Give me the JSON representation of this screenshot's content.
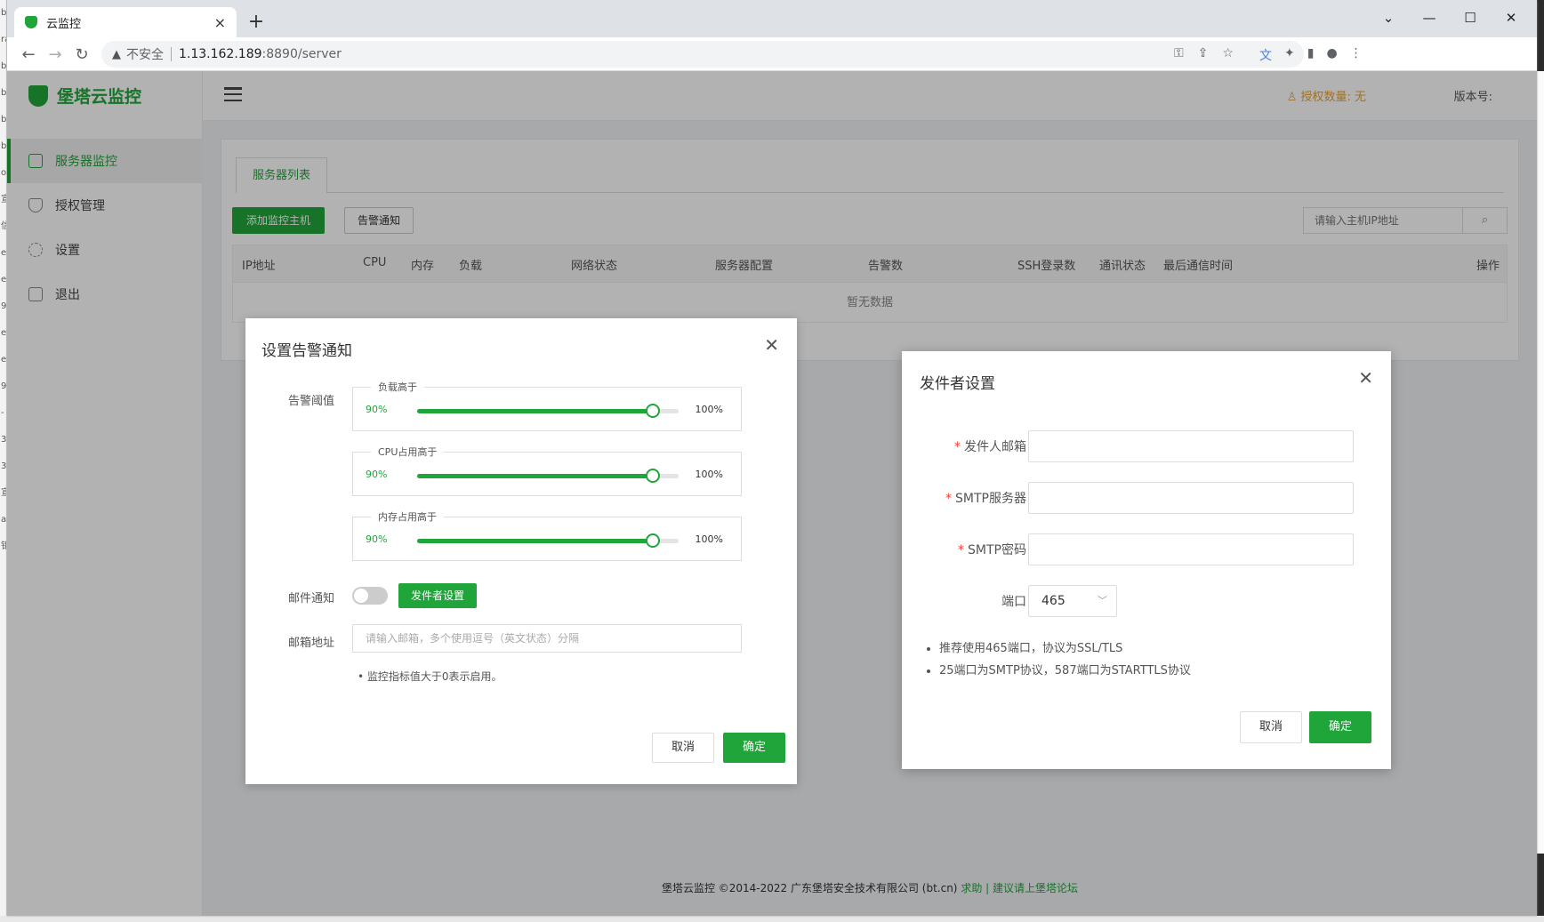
{
  "desktop": {
    "left_glyphs": [
      "b",
      "ra",
      "b",
      "b",
      "b",
      "b",
      "o",
      "宣",
      "信",
      "e",
      "e",
      "9",
      "e",
      "e",
      "9",
      "-",
      "3",
      "3",
      "宣",
      "a",
      "钜"
    ]
  },
  "browser": {
    "tab_title": "云监控",
    "tab_close": "×",
    "new_tab": "+",
    "security_label": "不安全",
    "url_host": "1.13.162.189",
    "url_rest": ":8890/server"
  },
  "app": {
    "brand": "堡塔云监控",
    "auth_text": "授权数量: 无",
    "version_label": "版本号:",
    "menu": [
      {
        "label": "服务器监控",
        "icon": "monitor-icon"
      },
      {
        "label": "授权管理",
        "icon": "shield-check-icon"
      },
      {
        "label": "设置",
        "icon": "gear-icon"
      },
      {
        "label": "退出",
        "icon": "logout-icon"
      }
    ],
    "tab_server_list": "服务器列表",
    "btn_add_host": "添加监控主机",
    "btn_alert_notify": "告警通知",
    "search_placeholder": "请输入主机IP地址",
    "columns": [
      "IP地址",
      "CPU",
      "内存",
      "负载",
      "网络状态",
      "服务器配置",
      "告警数",
      "SSH登录数",
      "通讯状态",
      "最后通信时间",
      "操作"
    ],
    "empty_text": "暂无数据",
    "footer_text": "堡塔云监控 ©2014-2022 广东堡塔安全技术有限公司 (bt.cn)",
    "footer_help": "求助",
    "footer_sep": "|",
    "footer_forum": "建议请上堡塔论坛"
  },
  "alert_dialog": {
    "title": "设置告警通知",
    "threshold_label": "告警阈值",
    "sliders": [
      {
        "legend": "负载高于",
        "value_text": "90%",
        "max_text": "100%",
        "value": 0.9
      },
      {
        "legend": "CPU占用高于",
        "value_text": "90%",
        "max_text": "100%",
        "value": 0.9
      },
      {
        "legend": "内存占用高于",
        "value_text": "90%",
        "max_text": "100%",
        "value": 0.9
      }
    ],
    "mail_notify_label": "邮件通知",
    "sender_settings_btn": "发件者设置",
    "email_label": "邮箱地址",
    "email_placeholder": "请输入邮箱，多个使用逗号（英文状态）分隔",
    "hint": "监控指标值大于0表示启用。",
    "cancel": "取消",
    "confirm": "确定"
  },
  "sender_dialog": {
    "title": "发件者设置",
    "required_mark": "*",
    "sender_email_label": "发件人邮箱",
    "smtp_server_label": "SMTP服务器",
    "smtp_password_label": "SMTP密码",
    "port_label": "端口",
    "port_value": "465",
    "tips": [
      "推荐使用465端口，协议为SSL/TLS",
      "25端口为SMTP协议，587端口为STARTTLS协议"
    ],
    "cancel": "取消",
    "confirm": "确定"
  },
  "colors": {
    "brand": "#20a53a",
    "warning": "#e6a23c",
    "required": "#f04134"
  }
}
